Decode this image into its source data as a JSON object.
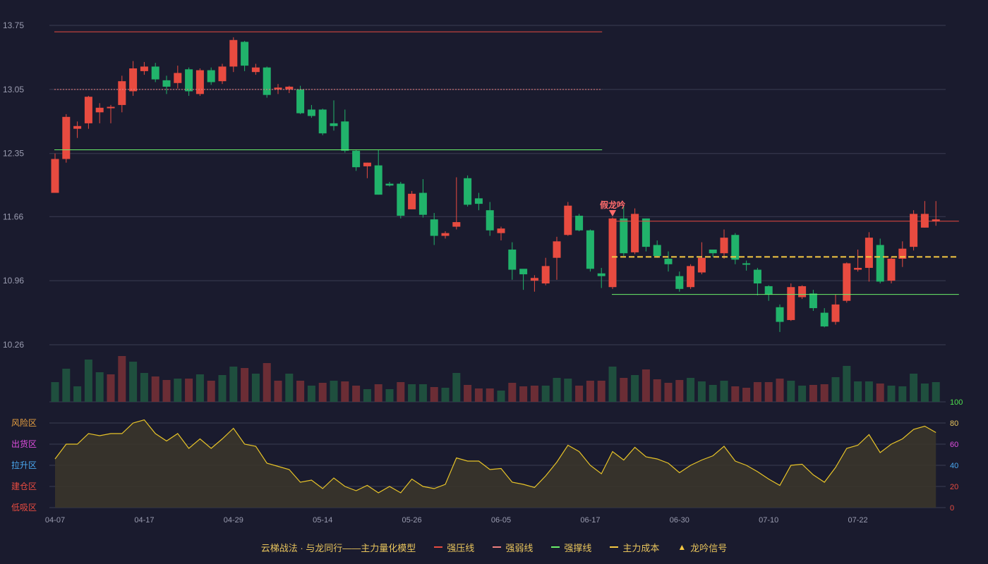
{
  "chart_data": {
    "type": "candlestick",
    "x_tick_labels": [
      "04-07",
      "04-17",
      "04-29",
      "05-14",
      "05-26",
      "06-05",
      "06-17",
      "06-30",
      "07-10",
      "07-22"
    ],
    "x_tick_indices": [
      0,
      8,
      16,
      24,
      32,
      40,
      48,
      56,
      64,
      72
    ],
    "price_axis": {
      "ticks": [
        "13.75",
        "13.05",
        "12.35",
        "11.66",
        "10.96",
        "10.26"
      ],
      "range": [
        10.26,
        13.75
      ]
    },
    "candles": [
      [
        11.92,
        12.29,
        11.92,
        12.35
      ],
      [
        12.29,
        12.75,
        12.25,
        12.78
      ],
      [
        12.62,
        12.65,
        12.52,
        12.7
      ],
      [
        12.68,
        12.97,
        12.62,
        12.98
      ],
      [
        12.8,
        12.85,
        12.68,
        12.9
      ],
      [
        12.85,
        12.86,
        12.68,
        12.88
      ],
      [
        12.88,
        13.14,
        12.8,
        13.2
      ],
      [
        13.03,
        13.28,
        12.98,
        13.36
      ],
      [
        13.25,
        13.3,
        13.21,
        13.35
      ],
      [
        13.3,
        13.16,
        13.13,
        13.34
      ],
      [
        13.15,
        13.08,
        13.0,
        13.2
      ],
      [
        13.12,
        13.23,
        13.06,
        13.31
      ],
      [
        13.27,
        13.03,
        12.98,
        13.29
      ],
      [
        13.0,
        13.26,
        12.98,
        13.28
      ],
      [
        13.26,
        13.13,
        13.1,
        13.29
      ],
      [
        13.14,
        13.3,
        13.11,
        13.33
      ],
      [
        13.3,
        13.59,
        13.24,
        13.62
      ],
      [
        13.57,
        13.31,
        13.25,
        13.58
      ],
      [
        13.24,
        13.29,
        13.21,
        13.33
      ],
      [
        13.29,
        12.99,
        12.96,
        13.3
      ],
      [
        13.05,
        13.07,
        13.0,
        13.11
      ],
      [
        13.05,
        13.08,
        13.01,
        13.09
      ],
      [
        13.05,
        12.79,
        12.78,
        13.09
      ],
      [
        12.83,
        12.76,
        12.74,
        12.88
      ],
      [
        12.83,
        12.57,
        12.55,
        12.84
      ],
      [
        12.68,
        12.65,
        12.6,
        12.93
      ],
      [
        12.7,
        12.38,
        12.36,
        12.83
      ],
      [
        12.38,
        12.2,
        12.16,
        12.39
      ],
      [
        12.21,
        12.25,
        12.08,
        12.25
      ],
      [
        12.22,
        11.9,
        11.9,
        12.39
      ],
      [
        12.02,
        12.0,
        11.99,
        12.04
      ],
      [
        12.02,
        11.67,
        11.64,
        12.04
      ],
      [
        11.74,
        11.91,
        11.74,
        11.94
      ],
      [
        11.92,
        11.68,
        11.65,
        12.07
      ],
      [
        11.63,
        11.45,
        11.35,
        11.7
      ],
      [
        11.45,
        11.48,
        11.42,
        11.5
      ],
      [
        11.55,
        11.6,
        11.52,
        12.09
      ],
      [
        12.08,
        11.79,
        11.77,
        12.11
      ],
      [
        11.86,
        11.8,
        11.73,
        11.92
      ],
      [
        11.73,
        11.51,
        11.45,
        11.82
      ],
      [
        11.48,
        11.53,
        11.4,
        11.55
      ],
      [
        11.3,
        11.08,
        10.97,
        11.38
      ],
      [
        11.09,
        11.03,
        10.86,
        11.06
      ],
      [
        10.96,
        10.99,
        10.84,
        11.02
      ],
      [
        10.93,
        11.12,
        10.91,
        11.21
      ],
      [
        11.21,
        11.39,
        10.97,
        11.44
      ],
      [
        11.46,
        11.78,
        11.45,
        11.82
      ],
      [
        11.67,
        11.51,
        11.5,
        11.69
      ],
      [
        11.51,
        11.09,
        11.06,
        11.52
      ],
      [
        11.04,
        11.01,
        10.88,
        11.1
      ],
      [
        10.89,
        11.64,
        10.87,
        11.65
      ],
      [
        11.64,
        11.26,
        11.23,
        11.77
      ],
      [
        11.27,
        11.69,
        11.25,
        11.75
      ],
      [
        11.64,
        11.33,
        11.28,
        11.64
      ],
      [
        11.35,
        11.23,
        11.21,
        11.4
      ],
      [
        11.2,
        11.14,
        11.06,
        11.28
      ],
      [
        11.01,
        10.87,
        10.84,
        11.06
      ],
      [
        10.89,
        11.12,
        10.87,
        11.14
      ],
      [
        11.05,
        11.21,
        11.03,
        11.38
      ],
      [
        11.3,
        11.26,
        11.22,
        11.3
      ],
      [
        11.26,
        11.43,
        11.2,
        11.52
      ],
      [
        11.46,
        11.19,
        11.14,
        11.48
      ],
      [
        11.15,
        11.14,
        11.07,
        11.18
      ],
      [
        11.08,
        10.93,
        10.8,
        11.1
      ],
      [
        10.9,
        10.81,
        10.74,
        10.91
      ],
      [
        10.67,
        10.51,
        10.4,
        10.7
      ],
      [
        10.53,
        10.89,
        10.52,
        10.93
      ],
      [
        10.78,
        10.9,
        10.76,
        10.91
      ],
      [
        10.82,
        10.66,
        10.63,
        10.86
      ],
      [
        10.61,
        10.46,
        10.45,
        10.66
      ],
      [
        10.51,
        10.7,
        10.48,
        10.81
      ],
      [
        10.74,
        11.15,
        10.72,
        11.16
      ],
      [
        11.08,
        11.1,
        11.06,
        11.3
      ],
      [
        11.1,
        11.43,
        10.95,
        11.49
      ],
      [
        11.35,
        10.95,
        10.93,
        11.42
      ],
      [
        10.96,
        11.2,
        10.93,
        11.22
      ],
      [
        11.2,
        11.31,
        11.11,
        11.39
      ],
      [
        11.33,
        11.69,
        11.29,
        11.73
      ],
      [
        11.54,
        11.69,
        11.54,
        11.83
      ],
      [
        11.61,
        11.63,
        11.56,
        11.83
      ]
    ],
    "volume": [
      [
        28,
        "down"
      ],
      [
        47,
        "down"
      ],
      [
        22,
        "down"
      ],
      [
        60,
        "down"
      ],
      [
        42,
        "down"
      ],
      [
        39,
        "up"
      ],
      [
        65,
        "up"
      ],
      [
        57,
        "down"
      ],
      [
        41,
        "down"
      ],
      [
        36,
        "up"
      ],
      [
        31,
        "up"
      ],
      [
        33,
        "down"
      ],
      [
        33,
        "up"
      ],
      [
        39,
        "down"
      ],
      [
        30,
        "up"
      ],
      [
        38,
        "down"
      ],
      [
        50,
        "down"
      ],
      [
        48,
        "up"
      ],
      [
        40,
        "down"
      ],
      [
        55,
        "up"
      ],
      [
        30,
        "up"
      ],
      [
        40,
        "down"
      ],
      [
        30,
        "up"
      ],
      [
        23,
        "down"
      ],
      [
        27,
        "up"
      ],
      [
        30,
        "down"
      ],
      [
        29,
        "up"
      ],
      [
        23,
        "up"
      ],
      [
        18,
        "down"
      ],
      [
        25,
        "up"
      ],
      [
        18,
        "down"
      ],
      [
        28,
        "up"
      ],
      [
        25,
        "down"
      ],
      [
        25,
        "down"
      ],
      [
        21,
        "up"
      ],
      [
        20,
        "down"
      ],
      [
        41,
        "down"
      ],
      [
        24,
        "up"
      ],
      [
        19,
        "up"
      ],
      [
        19,
        "up"
      ],
      [
        16,
        "down"
      ],
      [
        27,
        "up"
      ],
      [
        22,
        "up"
      ],
      [
        23,
        "up"
      ],
      [
        23,
        "down"
      ],
      [
        34,
        "down"
      ],
      [
        33,
        "down"
      ],
      [
        23,
        "up"
      ],
      [
        30,
        "up"
      ],
      [
        30,
        "up"
      ],
      [
        50,
        "down"
      ],
      [
        34,
        "up"
      ],
      [
        38,
        "down"
      ],
      [
        46,
        "up"
      ],
      [
        32,
        "up"
      ],
      [
        27,
        "up"
      ],
      [
        31,
        "up"
      ],
      [
        34,
        "down"
      ],
      [
        29,
        "down"
      ],
      [
        24,
        "down"
      ],
      [
        30,
        "down"
      ],
      [
        22,
        "up"
      ],
      [
        20,
        "up"
      ],
      [
        28,
        "up"
      ],
      [
        28,
        "up"
      ],
      [
        33,
        "up"
      ],
      [
        30,
        "down"
      ],
      [
        23,
        "down"
      ],
      [
        24,
        "up"
      ],
      [
        25,
        "up"
      ],
      [
        35,
        "down"
      ],
      [
        51,
        "down"
      ],
      [
        29,
        "down"
      ],
      [
        29,
        "down"
      ],
      [
        26,
        "up"
      ],
      [
        23,
        "down"
      ],
      [
        22,
        "down"
      ],
      [
        40,
        "down"
      ],
      [
        26,
        "down"
      ],
      [
        28,
        "down"
      ]
    ],
    "indicator": {
      "y_ticks": [
        "100",
        "80",
        "60",
        "40",
        "20",
        "0"
      ],
      "zones": [
        "风险区",
        "出货区",
        "拉升区",
        "建仓区",
        "低吸区"
      ],
      "values": [
        46,
        60,
        60,
        70,
        68,
        70,
        70,
        80,
        83,
        70,
        63,
        70,
        56,
        65,
        56,
        65,
        75,
        60,
        58,
        42,
        39,
        36,
        24,
        26,
        18,
        28,
        20,
        16,
        21,
        14,
        20,
        14,
        27,
        20,
        18,
        22,
        47,
        44,
        44,
        36,
        37,
        24,
        22,
        19,
        30,
        43,
        59,
        53,
        40,
        32,
        53,
        45,
        57,
        48,
        46,
        42,
        33,
        40,
        45,
        49,
        58,
        44,
        40,
        34,
        27,
        21,
        40,
        41,
        31,
        24,
        38,
        56,
        59,
        69,
        52,
        60,
        65,
        74,
        77,
        71
      ],
      "range": [
        0,
        100
      ]
    },
    "lines": [
      {
        "name": "强压线",
        "value": 13.68,
        "from": 0,
        "to": 49
      },
      {
        "name": "强弱线",
        "value": 13.05,
        "from": 0,
        "to": 49
      },
      {
        "name": "强撑线",
        "value": 12.39,
        "from": 0,
        "to": 49
      },
      {
        "name": "强压线",
        "value": 11.61,
        "from": 50,
        "to": 81
      },
      {
        "name": "主力成本",
        "value": 11.22,
        "from": 50,
        "to": 81
      },
      {
        "name": "强撑线",
        "value": 10.81,
        "from": 50,
        "to": 81
      }
    ],
    "annotation": {
      "label": "假龙吟",
      "index": 50
    }
  },
  "legend": {
    "title": "云梯战法 · 与龙同行——主力量化模型",
    "items": [
      {
        "label": "强压线",
        "color": "#e84b40",
        "style": "solid"
      },
      {
        "label": "强弱线",
        "color": "#ef7f7f",
        "style": "dash"
      },
      {
        "label": "强撑线",
        "color": "#6af06a",
        "style": "solid"
      },
      {
        "label": "主力成本",
        "color": "#f5c842",
        "style": "dash"
      },
      {
        "label": "龙吟信号",
        "color": "#f5c842",
        "style": "triangle"
      }
    ]
  },
  "colors": {
    "background": "#1a1b2e",
    "up": "#e84b40",
    "down": "#21b36b",
    "vol_up": "#6b2d35",
    "vol_down": "#1f4f3e",
    "grid": "#3a3c52",
    "axis_text": "#9a9cb0",
    "indicator_line": "#e8c428",
    "indicator_fill": "#3a352b"
  }
}
